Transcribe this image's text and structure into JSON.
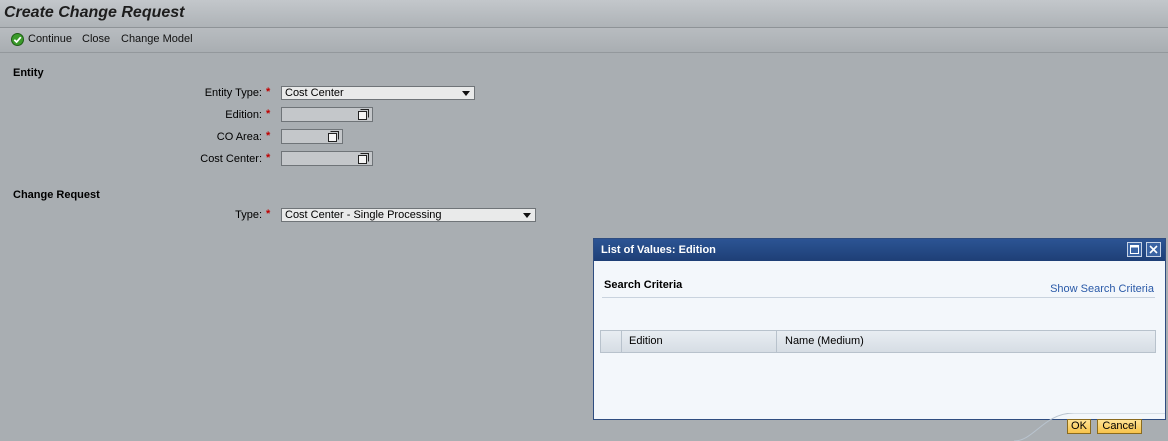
{
  "page": {
    "title": "Create Change Request"
  },
  "toolbar": {
    "continue_label": "Continue",
    "close_label": "Close",
    "change_model_label": "Change Model"
  },
  "entity": {
    "section_title": "Entity",
    "entity_type": {
      "label": "Entity Type:",
      "value": "Cost Center",
      "required_mark": "*"
    },
    "edition": {
      "label": "Edition:",
      "value": "",
      "required_mark": "*"
    },
    "co_area": {
      "label": "CO Area:",
      "value": "",
      "required_mark": "*"
    },
    "cost_center": {
      "label": "Cost Center:",
      "value": "",
      "required_mark": "*"
    }
  },
  "change_request": {
    "section_title": "Change Request",
    "type": {
      "label": "Type:",
      "value": "Cost Center - Single Processing",
      "required_mark": "*"
    }
  },
  "dialog": {
    "title": "List of Values: Edition",
    "search_criteria": "Search Criteria",
    "show_search_criteria": "Show Search Criteria",
    "columns": [
      "Edition",
      "Name (Medium)"
    ],
    "ok_label": "OK",
    "cancel_label": "Cancel"
  },
  "colors": {
    "background": "#a9aeb2",
    "dialog_header": "#1e3f76",
    "link": "#2a5aa8",
    "required": "#c00000",
    "button": "#f7c34b"
  }
}
